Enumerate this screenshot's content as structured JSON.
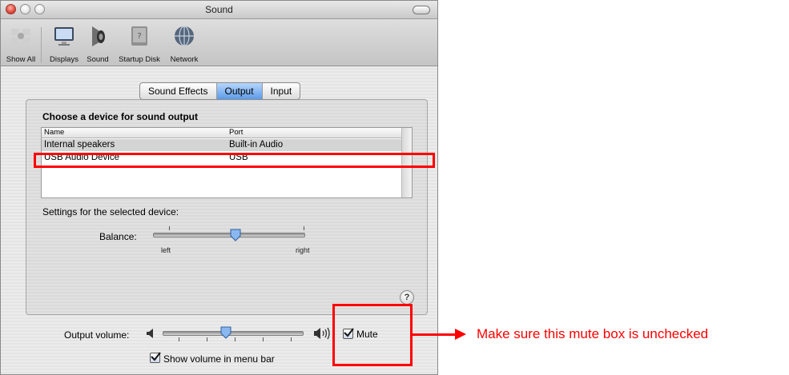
{
  "window": {
    "title": "Sound"
  },
  "toolbar": {
    "items": [
      {
        "label": "Show All",
        "icon": "show-all-icon"
      },
      {
        "label": "Displays",
        "icon": "display-icon"
      },
      {
        "label": "Sound",
        "icon": "speaker-icon"
      },
      {
        "label": "Startup Disk",
        "icon": "disk-icon"
      },
      {
        "label": "Network",
        "icon": "network-globe-icon"
      }
    ]
  },
  "tabs": [
    {
      "label": "Sound Effects",
      "selected": false
    },
    {
      "label": "Output",
      "selected": true
    },
    {
      "label": "Input",
      "selected": false
    }
  ],
  "output": {
    "heading": "Choose a device for sound output",
    "columns": [
      "Name",
      "Port"
    ],
    "devices": [
      {
        "name": "Internal speakers",
        "port": "Built-in Audio"
      },
      {
        "name": "USB Audio Device",
        "port": "USB"
      }
    ],
    "settings_label": "Settings for the selected device:",
    "balance": {
      "label": "Balance:",
      "left": "left",
      "right": "right",
      "value": 0.5
    }
  },
  "help_label": "?",
  "volume": {
    "label": "Output volume:",
    "value": 0.4
  },
  "mute": {
    "label": "Mute",
    "checked": true
  },
  "menu_bar": {
    "label": "Show volume in menu bar",
    "checked": true
  },
  "annotation": {
    "text": "Make sure this mute box is unchecked",
    "color": "#ff0000"
  }
}
